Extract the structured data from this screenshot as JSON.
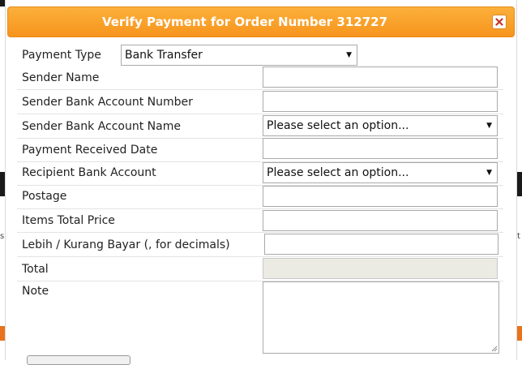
{
  "dialog": {
    "title": "Verify Payment for Order Number 312727",
    "close_icon": "close-icon"
  },
  "background": {
    "edge_chars": [
      "s",
      "t"
    ]
  },
  "form": {
    "payment_type": {
      "label": "Payment Type",
      "value": "Bank Transfer"
    },
    "sender_name": {
      "label": "Sender Name",
      "value": ""
    },
    "sender_account_number": {
      "label": "Sender Bank Account Number",
      "value": ""
    },
    "sender_account_name": {
      "label": "Sender Bank Account Name",
      "value": "Please select an option..."
    },
    "payment_received_date": {
      "label": "Payment Received Date",
      "value": ""
    },
    "recipient_account": {
      "label": "Recipient Bank Account",
      "value": "Please select an option..."
    },
    "postage": {
      "label": "Postage",
      "value": ""
    },
    "items_total_price": {
      "label": "Items Total Price",
      "value": ""
    },
    "adjustment": {
      "label": "Lebih / Kurang Bayar (, for decimals)",
      "value": ""
    },
    "total": {
      "label": "Total",
      "value": ""
    },
    "note": {
      "label": "Note",
      "value": ""
    }
  },
  "colors": {
    "titlebar": "#f7941d",
    "title_text": "#ffffff",
    "background_strip": "#1a1a1a",
    "background_accent": "#e8731c"
  }
}
